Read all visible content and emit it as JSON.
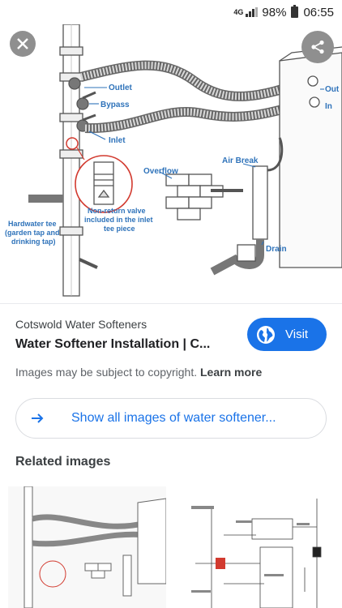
{
  "status_bar": {
    "network": "4G",
    "battery": "98%",
    "time": "06:55"
  },
  "diagram": {
    "labels": {
      "outlet": "Outlet",
      "bypass": "Bypass",
      "inlet": "Inlet",
      "overflow": "Overflow",
      "air_break": "Air Break",
      "out": "Out",
      "in": "In",
      "valve_1": "Non-return valve",
      "valve_2": "included in the inlet",
      "valve_3": "tee piece",
      "tee_1": "Hardwater tee",
      "tee_2": "(garden tap and",
      "tee_3": "drinking tap)",
      "drain": "Drain"
    }
  },
  "result": {
    "source": "Cotswold Water Softeners",
    "title": "Water Softener Installation | C...",
    "visit_label": "Visit",
    "copyright_text": "Images may be subject to copyright.",
    "learn_more": "Learn more",
    "show_all_label": "Show all images of water softener...",
    "related_title": "Related images"
  },
  "icons": {
    "close": "close-icon",
    "share": "share-icon",
    "globe": "globe-icon",
    "arrow": "arrow-right-icon"
  },
  "colors": {
    "accent": "#1a73e8",
    "diagram_label": "#2f73ba"
  }
}
